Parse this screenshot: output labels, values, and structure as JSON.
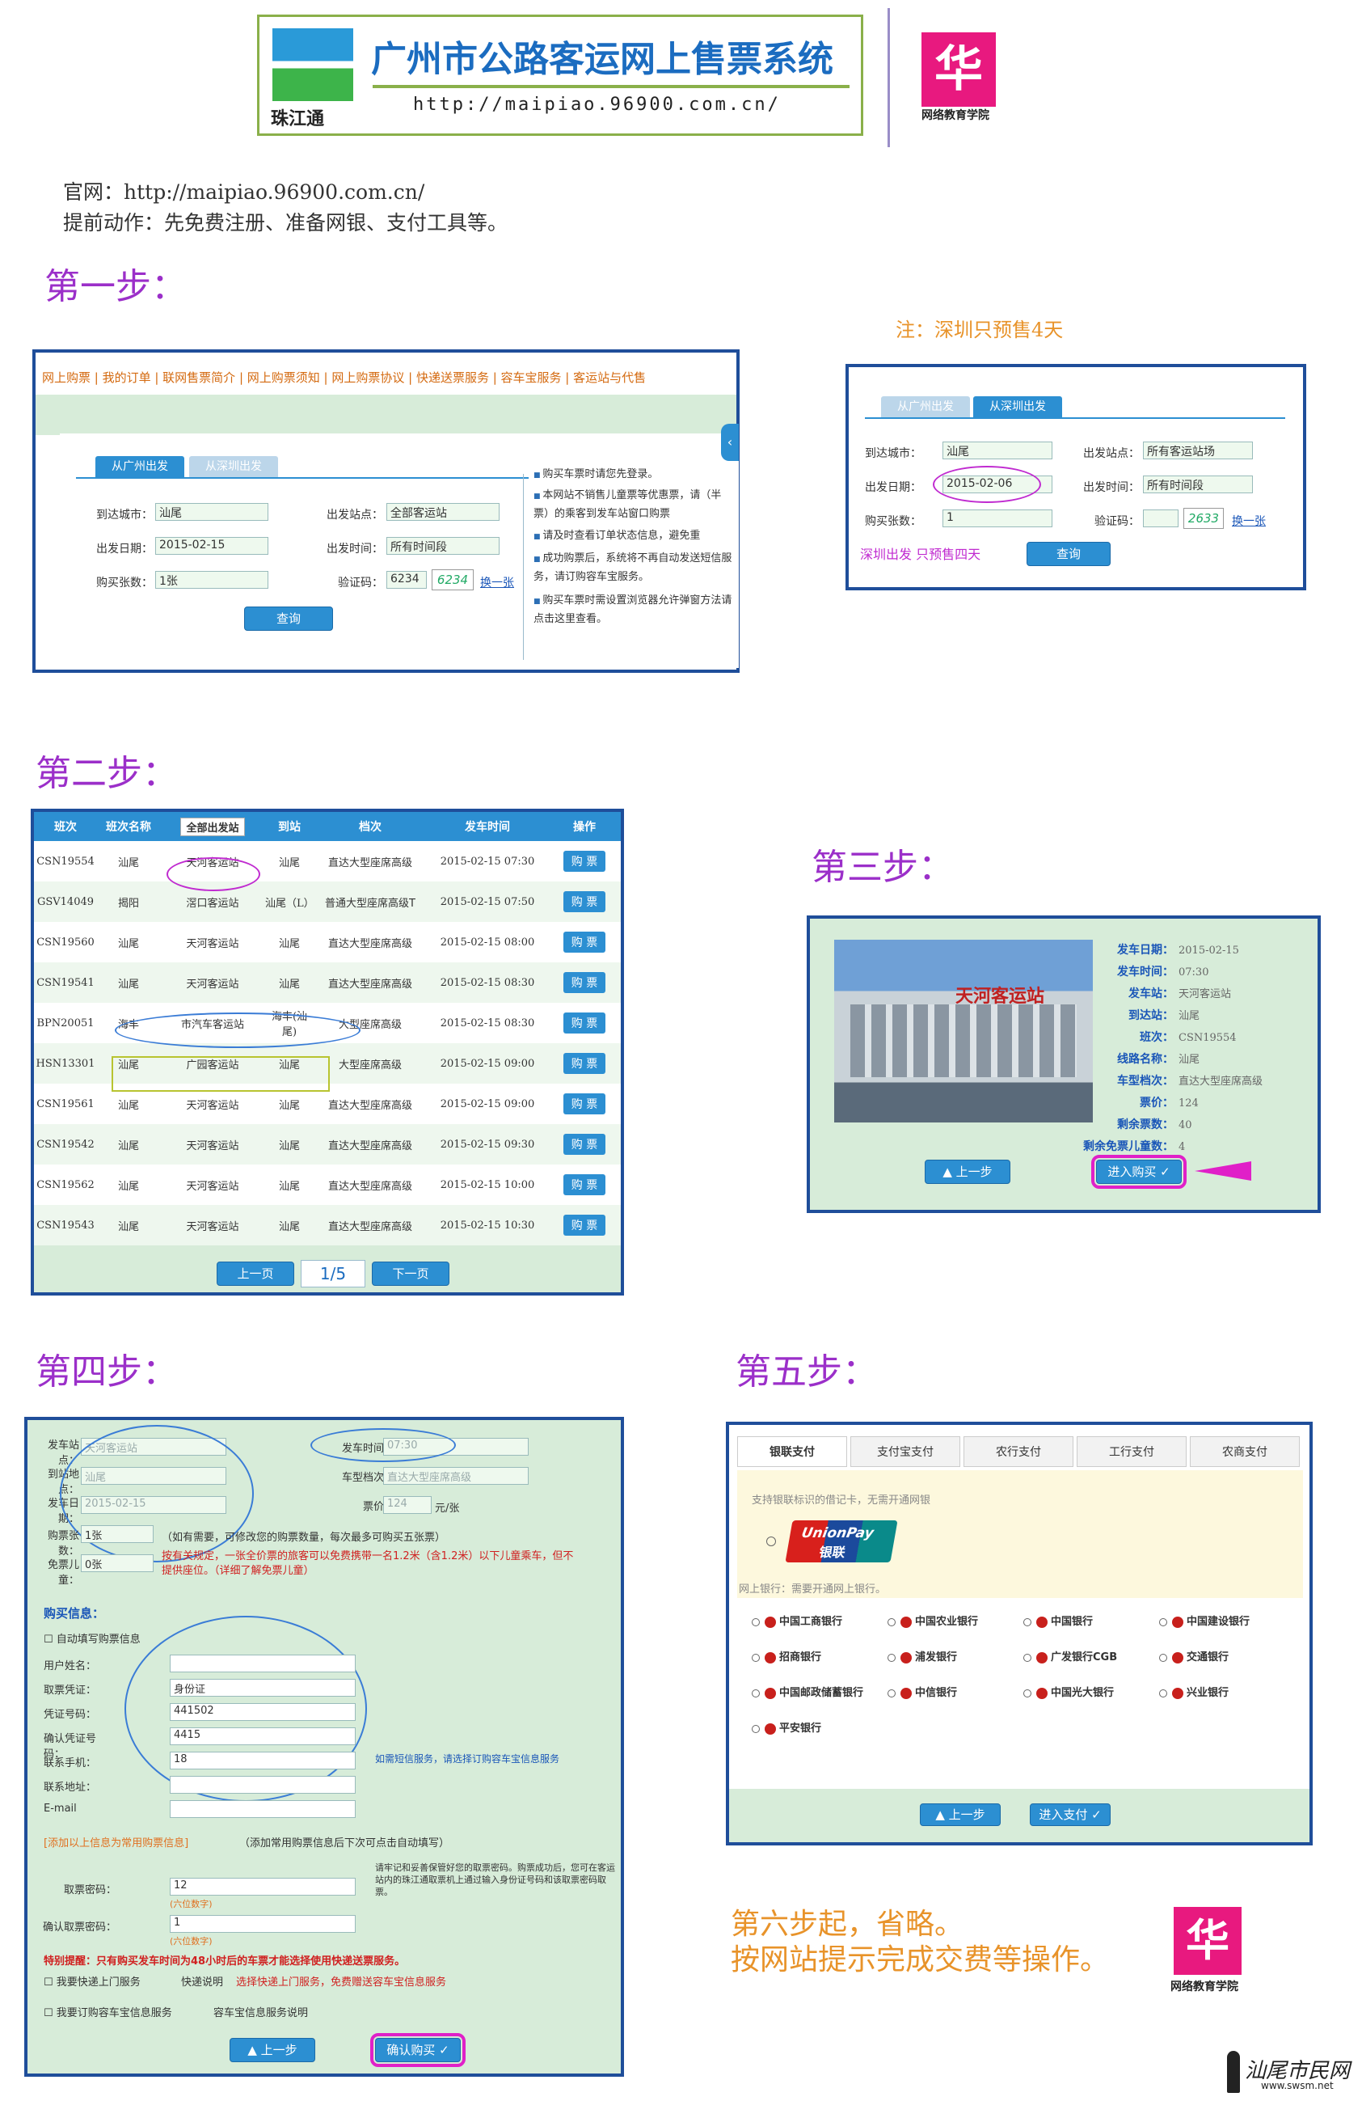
{
  "header": {
    "logo_caption": "珠江通",
    "title": "广州市公路客运网上售票系统",
    "url": "http://maipiao.96900.com.cn/",
    "brand_caption": "网络教育学院"
  },
  "intro": {
    "line1": "官网：http://maipiao.96900.com.cn/",
    "line2": "提前动作：先免费注册、准备网银、支付工具等。"
  },
  "steps": {
    "s1": "第一步：",
    "s2": "第二步：",
    "s3": "第三步：",
    "s4": "第四步：",
    "s5": "第五步：",
    "s6a": "第六步起，省略。",
    "s6b": "按网站提示完成交费等操作。"
  },
  "step1": {
    "nav": "网上购票 | 我的订单 | 联网售票简介 | 网上购票须知 | 网上购票协议 | 快递送票服务 | 容车宝服务 | 客运站与代售",
    "tab_gz": "从广州出发",
    "tab_sz": "从深圳出发",
    "labels": {
      "dest": "到达城市：",
      "from": "出发站点：",
      "date": "出发日期：",
      "time": "出发时间：",
      "count": "购买张数：",
      "code": "验证码："
    },
    "values": {
      "dest": "汕尾",
      "from": "全部客运站",
      "date": "2015-02-15",
      "time": "所有时间段",
      "count": "1张",
      "code": "6234",
      "captcha": "6234",
      "refresh": "换一张"
    },
    "query": "查询",
    "notes": [
      "购买车票时请您先登录。",
      "本网站不销售儿童票等优惠票，请（半票）的乘客到发车站窗口购票",
      "请及时查看订单状态信息，避免重",
      "成功购票后，系统将不再自动发送短信服务，请订购容车宝服务。",
      "购买车票时需设置浏览器允许弹窗方法请点击这里查看。"
    ]
  },
  "step1b": {
    "note": "注：深圳只预售4天",
    "tab_gz": "从广州出发",
    "tab_sz": "从深圳出发",
    "labels": {
      "dest": "到达城市：",
      "from": "出发站点：",
      "date": "出发日期：",
      "time": "出发时间：",
      "count": "购买张数：",
      "code": "验证码："
    },
    "values": {
      "dest": "汕尾",
      "from": "所有客运站场",
      "date": "2015-02-06",
      "time": "所有时间段",
      "count": "1",
      "captcha": "2633",
      "refresh": "换一张"
    },
    "hint": "深圳出发 只预售四天",
    "query": "查询"
  },
  "step2": {
    "headers": [
      "班次",
      "班次名称",
      "全部出发站",
      "到站",
      "档次",
      "发车时间",
      "操作"
    ],
    "rows": [
      [
        "CSN19554",
        "汕尾",
        "天河客运站",
        "汕尾",
        "直达大型座席高级",
        "2015-02-15 07:30"
      ],
      [
        "GSV14049",
        "揭阳",
        "滘口客运站",
        "汕尾（L）",
        "普通大型座席高级T",
        "2015-02-15 07:50"
      ],
      [
        "CSN19560",
        "汕尾",
        "天河客运站",
        "汕尾",
        "直达大型座席高级",
        "2015-02-15 08:00"
      ],
      [
        "CSN19541",
        "汕尾",
        "天河客运站",
        "汕尾",
        "直达大型座席高级",
        "2015-02-15 08:30"
      ],
      [
        "BPN20051",
        "海丰",
        "市汽车客运站",
        "海丰(汕尾)",
        "大型座席高级",
        "2015-02-15 08:30"
      ],
      [
        "HSN13301",
        "汕尾",
        "广园客运站",
        "汕尾",
        "大型座席高级",
        "2015-02-15 09:00"
      ],
      [
        "CSN19561",
        "汕尾",
        "天河客运站",
        "汕尾",
        "直达大型座席高级",
        "2015-02-15 09:00"
      ],
      [
        "CSN19542",
        "汕尾",
        "天河客运站",
        "汕尾",
        "直达大型座席高级",
        "2015-02-15 09:30"
      ],
      [
        "CSN19562",
        "汕尾",
        "天河客运站",
        "汕尾",
        "直达大型座席高级",
        "2015-02-15 10:00"
      ],
      [
        "CSN19543",
        "汕尾",
        "天河客运站",
        "汕尾",
        "直达大型座席高级",
        "2015-02-15 10:30"
      ]
    ],
    "buy": "购 票",
    "prev": "上一页",
    "page": "1/5",
    "next": "下一页"
  },
  "step3": {
    "photo_sign": "天河客运站",
    "fields": [
      [
        "发车日期：",
        "2015-02-15"
      ],
      [
        "发车时间：",
        "07:30"
      ],
      [
        "发车站：",
        "天河客运站"
      ],
      [
        "到达站：",
        "汕尾"
      ],
      [
        "班次：",
        "CSN19554"
      ],
      [
        "线路名称：",
        "汕尾"
      ],
      [
        "车型档次：",
        "直达大型座席高级"
      ],
      [
        "票价：",
        "124"
      ],
      [
        "剩余票数：",
        "40"
      ],
      [
        "剩余免票儿童数：",
        "4"
      ]
    ],
    "back": "▲ 上一步",
    "enter": "进入购买 ✓"
  },
  "step4": {
    "labels": {
      "from": "发车站点：",
      "dest": "到站地点：",
      "date": "发车日期：",
      "time": "发车时间：",
      "level": "车型档次：",
      "price": "票价：",
      "count": "购票张数：",
      "child": "免票儿童："
    },
    "values": {
      "from": "天河客运站",
      "dest": "汕尾",
      "date": "2015-02-15",
      "time": "07:30",
      "level": "直达大型座席高级",
      "price": "124",
      "unit": "元/张",
      "count": "1张",
      "child": "0张"
    },
    "count_hint": "（如有需要，可修改您的购票数量，每次最多可购买五张票）",
    "child_hint": "按有关规定，一张全价票的旅客可以免费携带一名1.2米（含1.2米）以下儿童乘车，但不提供座位。（详细了解免票儿童）",
    "info_title": "购买信息：",
    "auto_fill": "自动填写购票信息",
    "user_labels": [
      "用户姓名：",
      "取票凭证：",
      "凭证号码：",
      "确认凭证号码：",
      "联系手机：",
      "联系地址：",
      "E-mail"
    ],
    "user_values": [
      "",
      "身份证",
      "441502",
      "4415",
      "18",
      "",
      ""
    ],
    "sms_hint": "如需短信服务，请选择订购容车宝信息服务",
    "save_common": "[添加以上信息为常用购票信息]",
    "save_hint": "（添加常用购票信息后下次可点击自动填写）",
    "pwd_label": "取票密码：",
    "pwd_confirm": "确认取票密码：",
    "pwd_value": "12",
    "pwd_confirm_value": "1",
    "pwd_sub": "(六位数字)",
    "pwd_hint": "请牢记和妥善保管好您的取票密码。购票成功后，您可在客运站内的珠江通取票机上通过输入身份证号码和该取票密码取票。",
    "warn": "特别提醒：只有购买发车时间为48小时后的车票才能选择使用快递送票服务。",
    "express": "我要快递上门服务",
    "express_link": "快递说明",
    "express_hint": "选择快递上门服务，免费赠送容车宝信息服务",
    "sub": "我要订购容车宝信息服务",
    "sub_link": "容车宝信息服务说明",
    "back": "▲ 上一步",
    "confirm": "确认购买 ✓"
  },
  "step5": {
    "tabs": [
      "银联支付",
      "支付宝支付",
      "农行支付",
      "工行支付",
      "农商支付"
    ],
    "hint": "支持银联标识的借记卡，无需开通网银",
    "unionpay": "UnionPay",
    "unionpay_cn": "银联",
    "bank_hint": "网上银行：需要开通网上银行。",
    "banks": [
      "中国工商银行",
      "中国农业银行",
      "中国银行",
      "中国建设银行",
      "招商银行",
      "浦发银行",
      "广发银行CGB",
      "交通银行",
      "中国邮政储蓄银行",
      "中信银行",
      "中国光大银行",
      "兴业银行",
      "平安银行"
    ],
    "back": "▲ 上一步",
    "pay": "进入支付 ✓"
  },
  "footer": {
    "brand_caption": "网络教育学院",
    "watermark": "汕尾市民网",
    "watermark_url": "www.swsm.net"
  },
  "colors": {
    "accent": "#9b2fc9",
    "panel": "#d7ecd9",
    "border": "#1f4e9a",
    "button": "#2c8fd2",
    "highlight": "#e020c8"
  }
}
